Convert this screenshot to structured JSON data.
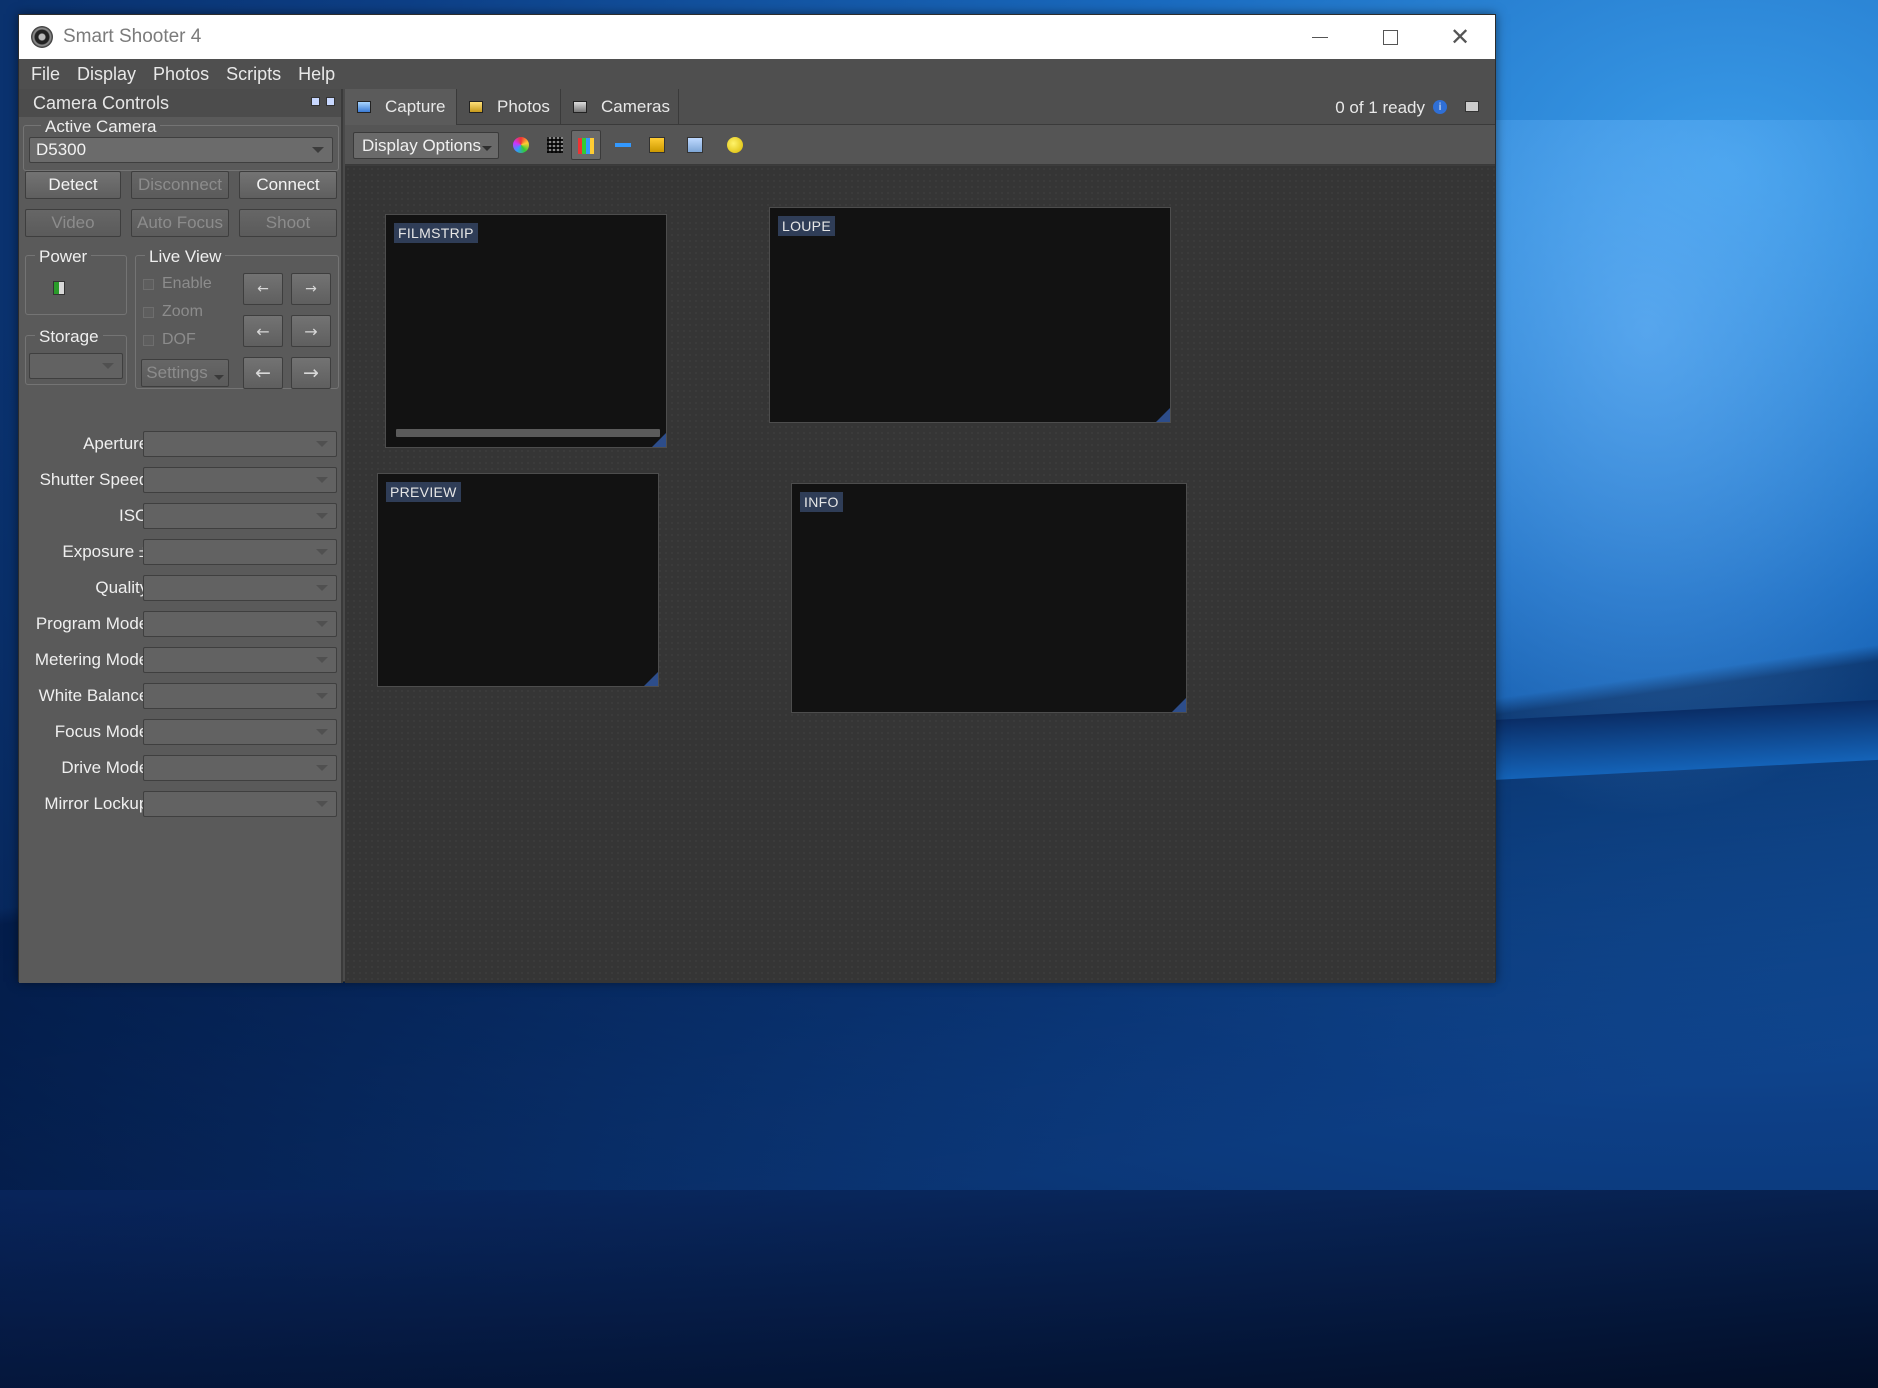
{
  "window": {
    "title": "Smart Shooter 4"
  },
  "menu": [
    "File",
    "Display",
    "Photos",
    "Scripts",
    "Help"
  ],
  "dock": {
    "title": "Camera Controls",
    "active_camera_label": "Active Camera",
    "active_camera_value": "D5300",
    "buttons_row1": [
      "Detect",
      "Disconnect",
      "Connect"
    ],
    "buttons_row2": [
      "Video",
      "Auto Focus",
      "Shoot"
    ],
    "power_label": "Power",
    "storage_label": "Storage",
    "liveview_label": "Live View",
    "liveview_checks": [
      "Enable",
      "Zoom",
      "DOF"
    ],
    "settings_label": "Settings",
    "properties": [
      "Aperture:",
      "Shutter Speed:",
      "ISO:",
      "Exposure ±:",
      "Quality:",
      "Program Mode:",
      "Metering Mode:",
      "White Balance:",
      "Focus Mode:",
      "Drive Mode:",
      "Mirror Lockup:"
    ]
  },
  "tabs": [
    "Capture",
    "Photos",
    "Cameras"
  ],
  "status": "0 of 1 ready",
  "toolbar": {
    "display_options": "Display Options"
  },
  "panels": {
    "filmstrip": "FILMSTRIP",
    "loupe": "LOUPE",
    "preview": "PREVIEW",
    "info": "INFO"
  },
  "icons": [
    "app-icon",
    "colour-wheel-icon",
    "grid-icon",
    "histogram-icon",
    "ruler-icon",
    "overlay-icon",
    "screen-icon",
    "bulb-icon",
    "info-icon"
  ],
  "colors": {
    "accent": "#2f3d57",
    "window_bg": "#4a4a4a",
    "desktop": "#0d3f86"
  }
}
